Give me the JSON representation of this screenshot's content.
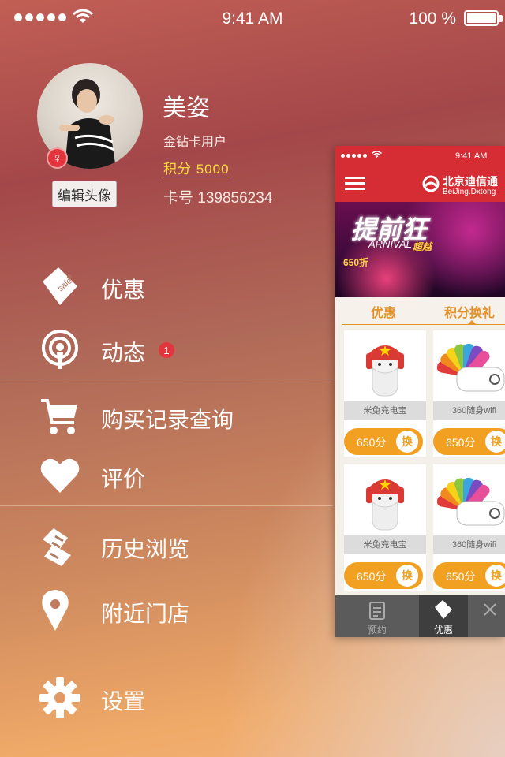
{
  "status_bar": {
    "time": "9:41 AM",
    "battery_text": "100 %"
  },
  "profile": {
    "name": "美姿",
    "level": "金钻卡用户",
    "points": "积分  5000",
    "card_no": "卡号 139856234",
    "edit_avatar_label": "编辑头像",
    "gender_symbol": "♀"
  },
  "menu": {
    "items": [
      {
        "label": "优惠",
        "icon": "sale-tag-icon"
      },
      {
        "label": "动态",
        "icon": "podcast-icon",
        "badge": "1"
      },
      {
        "label": "购买记录查询",
        "icon": "shopping-cart-icon"
      },
      {
        "label": "评价",
        "icon": "heart-icon"
      },
      {
        "label": "历史浏览",
        "icon": "scroll-history-icon"
      },
      {
        "label": "附近门店",
        "icon": "location-pin-icon"
      },
      {
        "label": "设置",
        "icon": "gear-icon"
      }
    ]
  },
  "preview": {
    "status_time": "9:41 AM",
    "brand": "北京迪信通",
    "brand_en": "BeiJing.Dxtong",
    "banner": {
      "title": "提前狂",
      "subtitle": "ARNIVAL",
      "subtitle2": "超越",
      "figure": "650折"
    },
    "tabs": [
      "优惠",
      "积分换礼"
    ],
    "products": [
      {
        "name": "米兔充电宝",
        "price": "650分",
        "action": "换"
      },
      {
        "name": "360随身wifi",
        "price": "650分",
        "action": "换"
      },
      {
        "name": "米兔充电宝",
        "price": "650分",
        "action": "换"
      },
      {
        "name": "360随身wifi",
        "price": "650分",
        "action": "换"
      }
    ],
    "tabbar": [
      "预约",
      "优惠"
    ]
  },
  "colors": {
    "accent_red": "#d62d35",
    "points_yellow": "#ffdf3d",
    "price_orange": "#f1a021"
  }
}
